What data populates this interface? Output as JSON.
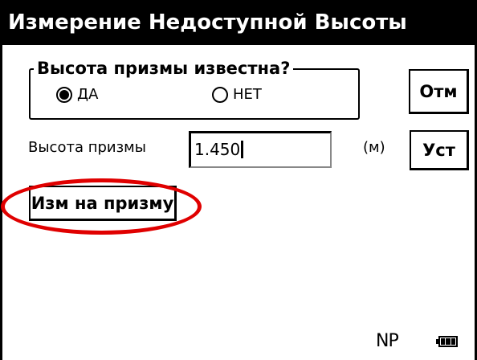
{
  "window": {
    "title": "Измерение Недоступной Высоты"
  },
  "prism_known": {
    "legend": "Высота призмы известна?",
    "options": [
      {
        "label": "ДА",
        "selected": true
      },
      {
        "label": "НЕТ",
        "selected": false
      }
    ]
  },
  "buttons": {
    "cancel": "Отм",
    "set": "Уст",
    "measure_prism": "Изм на призму"
  },
  "prism_height": {
    "label": "Высота призмы",
    "value": "1.450",
    "unit": "(м)"
  },
  "status": {
    "mode": "NP",
    "battery_icon": "battery-full-icon"
  },
  "colors": {
    "title_bg": "#000000",
    "title_fg": "#ffffff",
    "annotation": "#e00000"
  }
}
